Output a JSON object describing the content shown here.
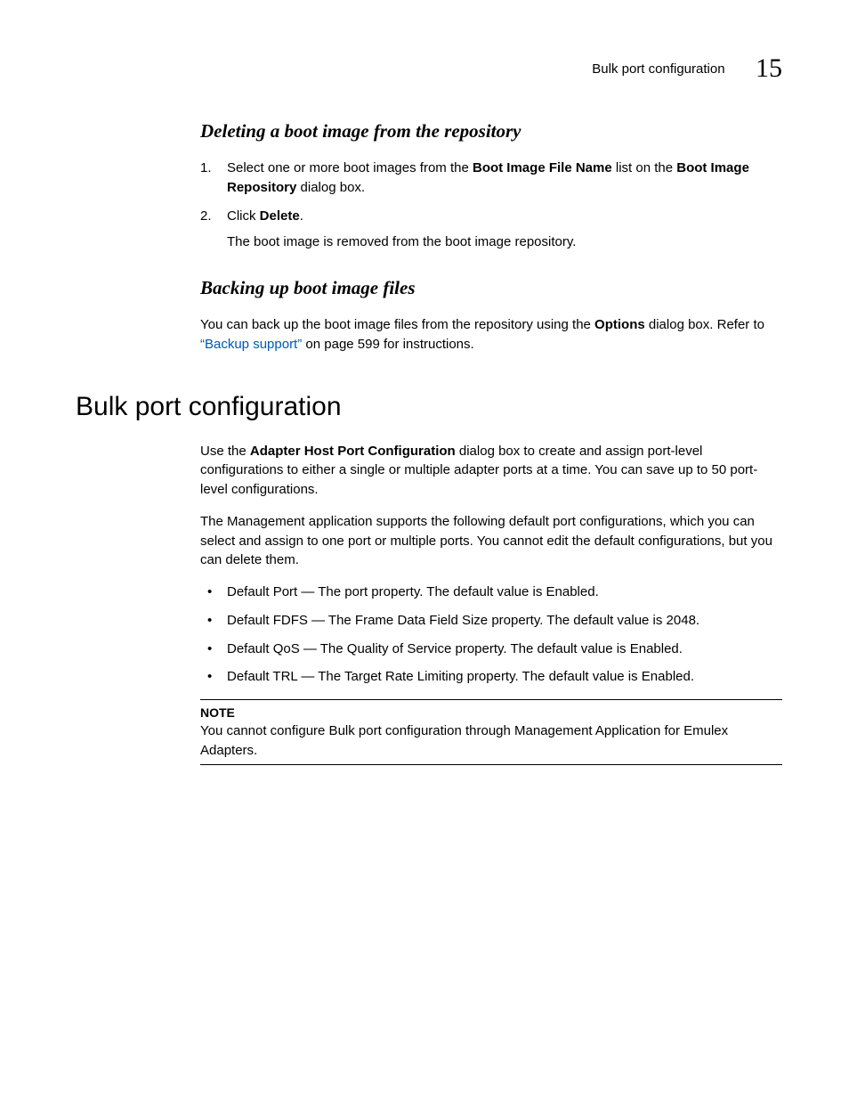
{
  "header": {
    "section_label": "Bulk port configuration",
    "chapter_number": "15"
  },
  "sections": {
    "delete": {
      "title": "Deleting a boot image from the repository",
      "step1_lead": "Select one or more boot images from the ",
      "step1_bold1": "Boot Image File Name",
      "step1_mid": " list on the ",
      "step1_bold2": "Boot Image Repository",
      "step1_tail": " dialog box.",
      "step2_lead": "Click ",
      "step2_bold": "Delete",
      "step2_tail": ".",
      "step2_result": "The boot image is removed from the boot image repository."
    },
    "backup": {
      "title": "Backing up boot image files",
      "para_lead": "You can back up the boot image files from the repository using the ",
      "para_bold": "Options",
      "para_mid": " dialog box. Refer to ",
      "para_link": "“Backup support”",
      "para_tail": " on page 599 for instructions."
    },
    "bulk": {
      "title": "Bulk port configuration",
      "p1_lead": "Use the ",
      "p1_bold": "Adapter Host Port Configuration",
      "p1_tail": " dialog box to create and assign port-level configurations to either a single or multiple adapter ports at a time. You can save up to 50 port-level configurations.",
      "p2": "The Management application supports the following default port configurations, which you can select and assign to one port or multiple ports. You cannot edit the default configurations, but you can delete them.",
      "bullets": [
        "Default Port — The port property. The default value is Enabled.",
        "Default FDFS — The Frame Data Field Size property. The default value is 2048.",
        "Default QoS — The Quality of Service property. The default value is Enabled.",
        "Default TRL — The Target Rate Limiting property. The default value is Enabled."
      ],
      "note_label": "NOTE",
      "note_body": "You cannot configure Bulk port configuration through Management Application for Emulex Adapters."
    }
  }
}
